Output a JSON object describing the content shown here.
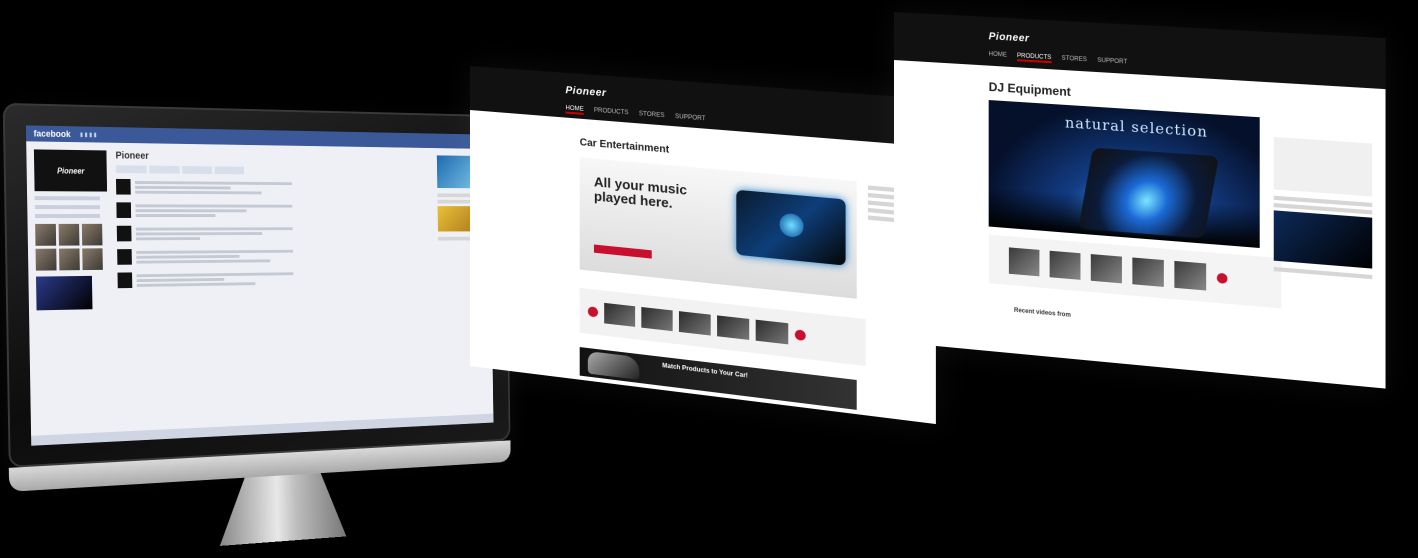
{
  "facebook": {
    "logo": "facebook",
    "page_name": "Pioneer",
    "profile_logo": "Pioneer"
  },
  "car_page": {
    "logo": "Pioneer",
    "nav": [
      "HOME",
      "PRODUCTS",
      "STORES",
      "SUPPORT"
    ],
    "title": "Car Entertainment",
    "hero_text": "All your music played here.",
    "match_text": "Match Products to Your Car!"
  },
  "dj_page": {
    "logo": "Pioneer",
    "nav": [
      "HOME",
      "PRODUCTS",
      "STORES",
      "SUPPORT"
    ],
    "title": "DJ Equipment",
    "hero_text": "natural selection",
    "videos_text": "Recent videos from"
  }
}
